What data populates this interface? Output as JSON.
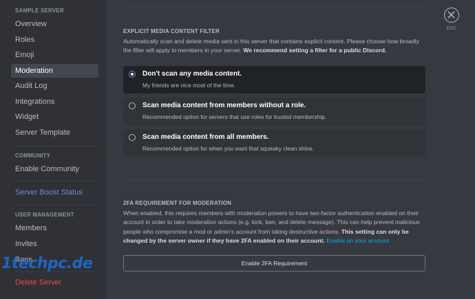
{
  "sidebar": {
    "sections": [
      {
        "header": "Sample Server",
        "items": [
          "Overview",
          "Roles",
          "Emoji",
          "Moderation",
          "Audit Log",
          "Integrations",
          "Widget",
          "Server Template"
        ]
      },
      {
        "header": "Community",
        "items": [
          "Enable Community"
        ]
      },
      {
        "header": "",
        "items": [
          "Server Boost Status"
        ]
      },
      {
        "header": "User Management",
        "items": [
          "Members",
          "Invites",
          "Bans"
        ]
      },
      {
        "header": "",
        "items": [
          "Delete Server"
        ]
      }
    ],
    "active_item": "Moderation"
  },
  "watermark": "1techpc.de",
  "close": {
    "label": "ESC"
  },
  "media_filter": {
    "heading": "Explicit Media Content Filter",
    "description_plain": "Automatically scan and delete media sent in this server that contains explicit content. Please choose how broadly the filter will apply to members in your server.",
    "description_bold": "We recommend setting a filter for a public Discord.",
    "options": [
      {
        "title": "Don't scan any media content.",
        "subtitle": "My friends are nice most of the time.",
        "selected": true
      },
      {
        "title": "Scan media content from members without a role.",
        "subtitle": "Recommended option for servers that use roles for trusted membership.",
        "selected": false
      },
      {
        "title": "Scan media content from all members.",
        "subtitle": "Recommended option for when you want that squeaky clean shine.",
        "selected": false
      }
    ]
  },
  "twofa": {
    "heading": "2FA Requirement for Moderation",
    "description_plain": "When enabled, this requires members with moderation powers to have two-factor authentication enabled on their account in order to take moderation actions (e.g. kick, ban, and delete message). This can help prevent malicious people who compromise a mod or admin's account from taking destructive actions.",
    "description_bold": "This setting can only be changed by the server owner if they have 2FA enabled on their account.",
    "link_text": "Enable on your account.",
    "button_label": "Enable 2FA Requirement"
  },
  "colors": {
    "background": "#36393f",
    "sidebar": "#2f3136",
    "accent": "#7289da",
    "danger": "#f04747",
    "link": "#00b0f4"
  }
}
